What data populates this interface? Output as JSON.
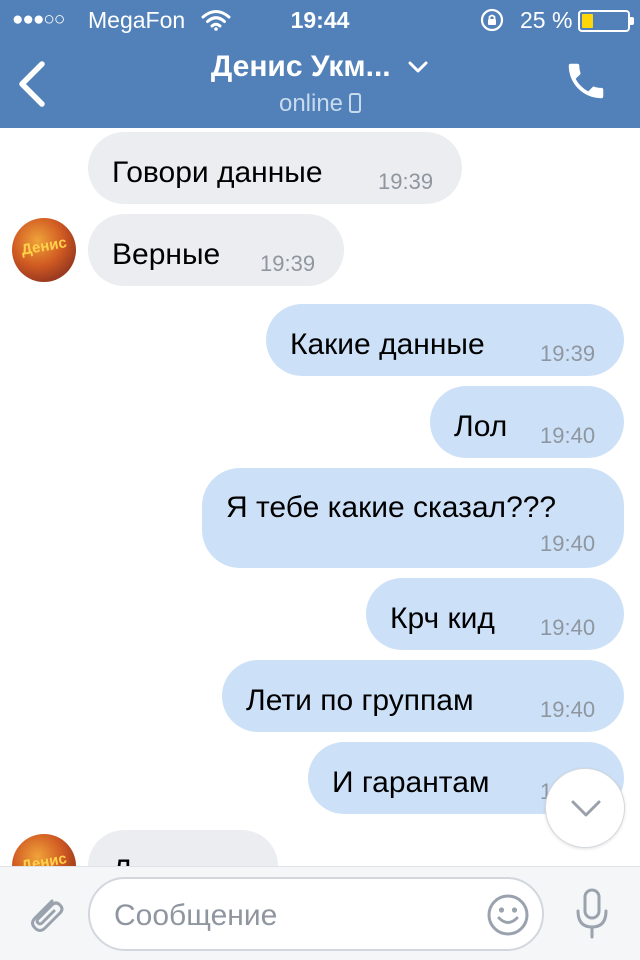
{
  "status_bar": {
    "signal": "●●●○○",
    "carrier": "MegaFon",
    "time": "19:44",
    "battery_percent": "25 %",
    "battery_level": 0.25,
    "battery_color": "#ffd60a"
  },
  "header": {
    "contact_name": "Денис Укм...",
    "status": "online",
    "status_device_icon": "mobile-icon",
    "back_icon": "chevron-left-icon",
    "call_icon": "phone-icon",
    "accent_color": "#5181b8"
  },
  "messages": [
    {
      "direction": "in",
      "text": "Говори данные",
      "time": "19:39"
    },
    {
      "direction": "in",
      "text": "Верные",
      "time": "19:39",
      "avatar_text": "Денис"
    },
    {
      "direction": "out",
      "text": "Какие данные",
      "time": "19:39"
    },
    {
      "direction": "out",
      "text": "Лол",
      "time": "19:40"
    },
    {
      "direction": "out",
      "text": "Я тебе какие сказал???",
      "time": "19:40"
    },
    {
      "direction": "out",
      "text": "Крч кид",
      "time": "19:40"
    },
    {
      "direction": "out",
      "text": "Лети по группам",
      "time": "19:40"
    },
    {
      "direction": "out",
      "text": "И гарантам",
      "time": "19:40"
    },
    {
      "direction": "in",
      "text": "Д",
      "time": "",
      "avatar_text": "Денис"
    }
  ],
  "input": {
    "placeholder": "Сообщение",
    "attach_icon": "paperclip-icon",
    "emoji_icon": "smiley-icon",
    "mic_icon": "microphone-icon"
  },
  "scroll_down_icon": "chevron-down-icon"
}
